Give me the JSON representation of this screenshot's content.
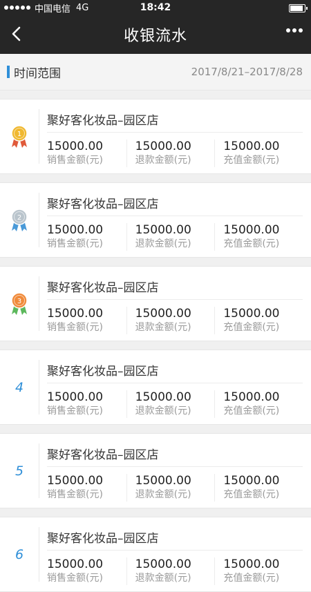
{
  "status_bar": {
    "carrier": "中国电信",
    "network": "4G",
    "time": "18:42"
  },
  "nav": {
    "title": "收银流水"
  },
  "range": {
    "label": "时间范围",
    "value": "2017/8/21–2017/8/28"
  },
  "colors": {
    "accent": "#2f8fd8",
    "header_bg": "#262626",
    "gold": "#f0b830",
    "silver": "#b9c4cc",
    "bronze": "#f08a3a"
  },
  "cards": [
    {
      "rank": "1",
      "medal": "gold",
      "store": "聚好客化妆品–园区店",
      "stats": [
        {
          "value": "15000.00",
          "label": "销售金额(元)"
        },
        {
          "value": "15000.00",
          "label": "退款金额(元)"
        },
        {
          "value": "15000.00",
          "label": "充值金额(元)"
        }
      ]
    },
    {
      "rank": "2",
      "medal": "silver",
      "store": "聚好客化妆品–园区店",
      "stats": [
        {
          "value": "15000.00",
          "label": "销售金额(元)"
        },
        {
          "value": "15000.00",
          "label": "退款金额(元)"
        },
        {
          "value": "15000.00",
          "label": "充值金额(元)"
        }
      ]
    },
    {
      "rank": "3",
      "medal": "bronze",
      "store": "聚好客化妆品–园区店",
      "stats": [
        {
          "value": "15000.00",
          "label": "销售金额(元)"
        },
        {
          "value": "15000.00",
          "label": "退款金额(元)"
        },
        {
          "value": "15000.00",
          "label": "充值金额(元)"
        }
      ]
    },
    {
      "rank": "4",
      "medal": "",
      "store": "聚好客化妆品–园区店",
      "stats": [
        {
          "value": "15000.00",
          "label": "销售金额(元)"
        },
        {
          "value": "15000.00",
          "label": "退款金额(元)"
        },
        {
          "value": "15000.00",
          "label": "充值金额(元)"
        }
      ]
    },
    {
      "rank": "5",
      "medal": "",
      "store": "聚好客化妆品–园区店",
      "stats": [
        {
          "value": "15000.00",
          "label": "销售金额(元)"
        },
        {
          "value": "15000.00",
          "label": "退款金额(元)"
        },
        {
          "value": "15000.00",
          "label": "充值金额(元)"
        }
      ]
    },
    {
      "rank": "6",
      "medal": "",
      "store": "聚好客化妆品–园区店",
      "stats": [
        {
          "value": "15000.00",
          "label": "销售金额(元)"
        },
        {
          "value": "15000.00",
          "label": "退款金额(元)"
        },
        {
          "value": "15000.00",
          "label": "充值金额(元)"
        }
      ]
    }
  ]
}
